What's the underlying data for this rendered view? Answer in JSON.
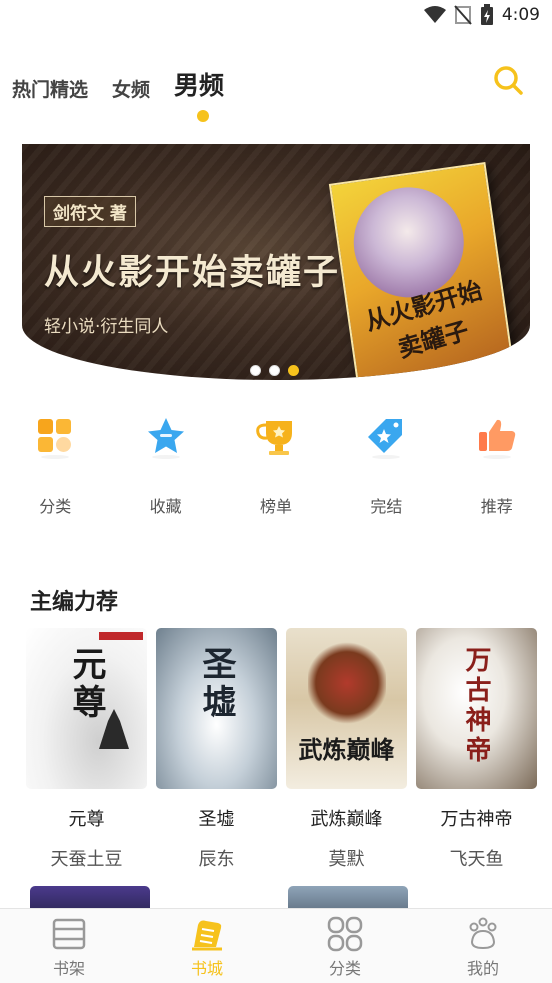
{
  "status_bar": {
    "time": "4:09"
  },
  "tabs": [
    {
      "label": "热门精选",
      "active": false
    },
    {
      "label": "女频",
      "active": false
    },
    {
      "label": "男频",
      "active": true
    }
  ],
  "accent_color": "#f6c21c",
  "banner": {
    "author_tag": "剑符文 著",
    "title": "从火影开始卖罐子",
    "subtitle": "轻小说·衍生同人",
    "book_cover_title": "从火影开始卖罐子",
    "dots": 3,
    "active_dot": 2
  },
  "quick_nav": [
    {
      "label": "分类",
      "icon": "category-grid-icon"
    },
    {
      "label": "收藏",
      "icon": "star-icon"
    },
    {
      "label": "榜单",
      "icon": "trophy-icon"
    },
    {
      "label": "完结",
      "icon": "tag-star-icon"
    },
    {
      "label": "推荐",
      "icon": "thumbs-up-icon"
    }
  ],
  "section": {
    "title": "主编力荐",
    "books": [
      {
        "name": "元尊",
        "author": "天蚕土豆",
        "cover_text": "元尊"
      },
      {
        "name": "圣墟",
        "author": "辰东",
        "cover_text": "圣墟"
      },
      {
        "name": "武炼巅峰",
        "author": "莫默",
        "cover_text": "武炼巅峰"
      },
      {
        "name": "万古神帝",
        "author": "飞天鱼",
        "cover_text": "万古神帝"
      }
    ]
  },
  "bottom_nav": [
    {
      "label": "书架",
      "icon": "bookshelf-icon",
      "active": false
    },
    {
      "label": "书城",
      "icon": "bookstore-icon",
      "active": true
    },
    {
      "label": "分类",
      "icon": "category-icon",
      "active": false
    },
    {
      "label": "我的",
      "icon": "paw-profile-icon",
      "active": false
    }
  ]
}
